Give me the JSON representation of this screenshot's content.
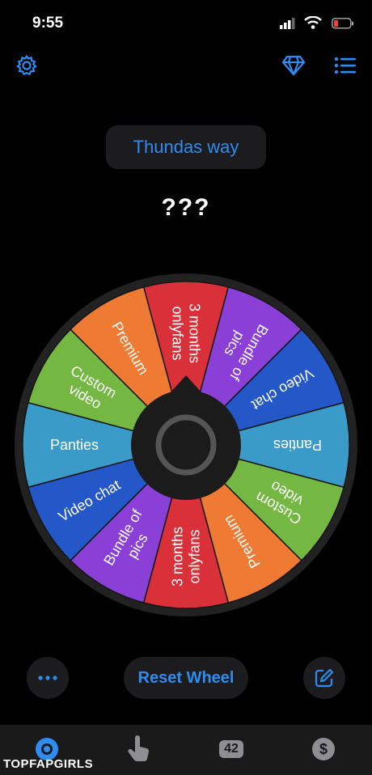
{
  "status": {
    "time": "9:55"
  },
  "header": {
    "wheel_name": "Thundas way",
    "settings_icon": "gear-icon",
    "premium_icon": "diamond-icon",
    "list_icon": "list-icon"
  },
  "result_text": "???",
  "wheel": {
    "segments": [
      {
        "label": [
          "3 months",
          "onlyfans"
        ],
        "color": "#d9303a"
      },
      {
        "label": [
          "Bundle of",
          "pics"
        ],
        "color": "#8a3fd6"
      },
      {
        "label": [
          "Video chat"
        ],
        "color": "#2457c8"
      },
      {
        "label": [
          "Panties"
        ],
        "color": "#3a9bc9"
      },
      {
        "label": [
          "Custom",
          "video"
        ],
        "color": "#74b843"
      },
      {
        "label": [
          "Premium"
        ],
        "color": "#ee7a34"
      },
      {
        "label": [
          "3 months",
          "onlyfans"
        ],
        "color": "#d9303a"
      },
      {
        "label": [
          "Bundle of",
          "pics"
        ],
        "color": "#8a3fd6"
      },
      {
        "label": [
          "Video chat"
        ],
        "color": "#2457c8"
      },
      {
        "label": [
          "Panties"
        ],
        "color": "#3a9bc9"
      },
      {
        "label": [
          "Custom",
          "video"
        ],
        "color": "#74b843"
      },
      {
        "label": [
          "Premium"
        ],
        "color": "#ee7a34"
      }
    ]
  },
  "controls": {
    "reset_label": "Reset Wheel",
    "more_icon": "more-icon",
    "edit_icon": "edit-icon"
  },
  "tabbar": {
    "counter": "42",
    "currency_symbol": "$"
  },
  "watermark": "TOPFAPGIRLS",
  "colors": {
    "accent": "#2f8cf0"
  }
}
